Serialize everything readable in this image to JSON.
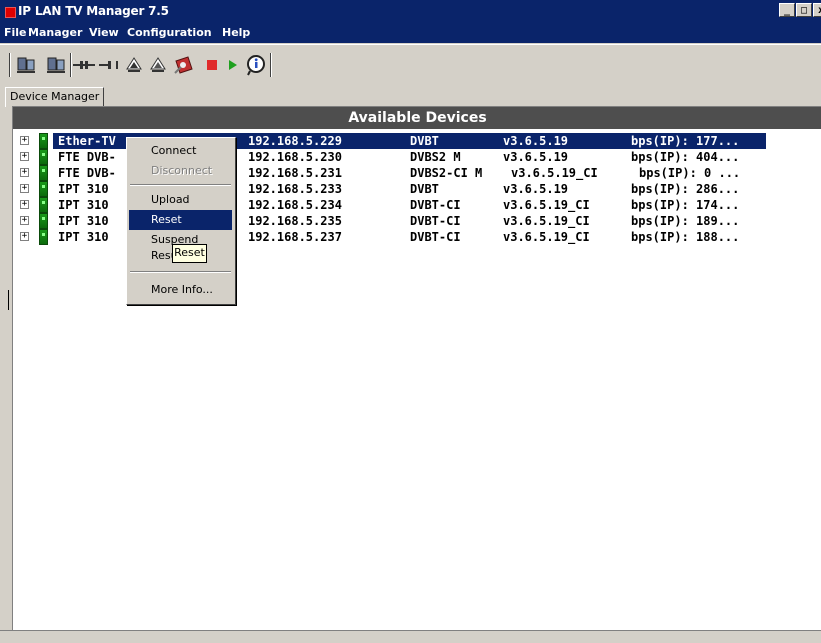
{
  "window": {
    "title": "IP LAN TV Manager 7.5",
    "controls": [
      "_",
      "□",
      "x"
    ]
  },
  "menubar": {
    "items": [
      "File",
      "Manager",
      "View",
      "Configuration",
      "Help"
    ]
  },
  "toolbar": {
    "buttons": [
      "device-list-icon",
      "device-add-icon",
      "connect-plug-icon",
      "disconnect-plug-icon",
      "upload-arrow-icon",
      "upload-all-arrow-icon",
      "configure-icon",
      "stop-icon",
      "play-icon",
      "info-icon"
    ]
  },
  "tabs": [
    "Device Manager"
  ],
  "panel": {
    "title": "Available Devices"
  },
  "devices": [
    {
      "name": "Ether-TV",
      "ip": "192.168.5.229",
      "type": "DVBT",
      "version": "v3.6.5.19",
      "bps": "bps(IP): 177..."
    },
    {
      "name": "FTE DVB-",
      "ip": "192.168.5.230",
      "type": "DVBS2 M",
      "version": "v3.6.5.19",
      "bps": "bps(IP): 404..."
    },
    {
      "name": "FTE DVB-",
      "ip": "192.168.5.231",
      "type": "DVBS2-CI M",
      "version": "v3.6.5.19_CI",
      "bps": "bps(IP): 0 ..."
    },
    {
      "name": "IPT 310",
      "ip": "192.168.5.233",
      "type": "DVBT",
      "version": "v3.6.5.19",
      "bps": "bps(IP): 286..."
    },
    {
      "name": "IPT 310",
      "ip": "192.168.5.234",
      "type": "DVBT-CI",
      "version": "v3.6.5.19_CI",
      "bps": "bps(IP): 174..."
    },
    {
      "name": "IPT 310",
      "ip": "192.168.5.235",
      "type": "DVBT-CI",
      "version": "v3.6.5.19_CI",
      "bps": "bps(IP): 189..."
    },
    {
      "name": "IPT 310",
      "ip": "192.168.5.237",
      "type": "DVBT-CI",
      "version": "v3.6.5.19_CI",
      "bps": "bps(IP): 188..."
    }
  ],
  "context_menu": {
    "connect": "Connect",
    "disconnect": "Disconnect",
    "upload": "Upload",
    "reset": "Reset",
    "suspend": "Suspend",
    "resume": "Resume",
    "more_info": "More Info..."
  },
  "tooltip": "Reset",
  "colors": {
    "titlebar": "#0a246a",
    "selection": "#0a246a",
    "header": "#4e4e4e",
    "face": "#d4d0c8"
  }
}
